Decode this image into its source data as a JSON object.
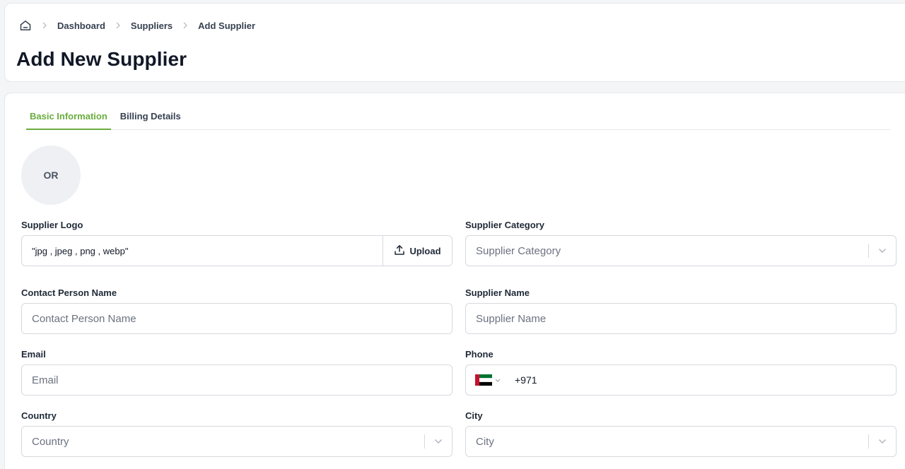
{
  "breadcrumb": {
    "home_icon": "home-icon",
    "items": [
      "Dashboard",
      "Suppliers",
      "Add Supplier"
    ]
  },
  "page": {
    "title": "Add New Supplier"
  },
  "tabs": [
    {
      "label": "Basic Information",
      "active": true
    },
    {
      "label": "Billing Details",
      "active": false
    }
  ],
  "avatar": {
    "initials": "OR"
  },
  "form": {
    "supplier_logo": {
      "label": "Supplier Logo",
      "hint": "\"jpg , jpeg , png , webp\"",
      "button": "Upload"
    },
    "supplier_category": {
      "label": "Supplier Category",
      "placeholder": "Supplier Category"
    },
    "contact_person": {
      "label": "Contact Person Name",
      "placeholder": "Contact Person Name"
    },
    "supplier_name": {
      "label": "Supplier Name",
      "placeholder": "Supplier Name"
    },
    "email": {
      "label": "Email",
      "placeholder": "Email"
    },
    "phone": {
      "label": "Phone",
      "country_code": "+971",
      "flag": "uae-flag-icon"
    },
    "country": {
      "label": "Country",
      "placeholder": "Country"
    },
    "city": {
      "label": "City",
      "placeholder": "City"
    }
  },
  "colors": {
    "accent": "#6aad3d",
    "border": "#d6d9de",
    "background": "#f4f5f7"
  }
}
